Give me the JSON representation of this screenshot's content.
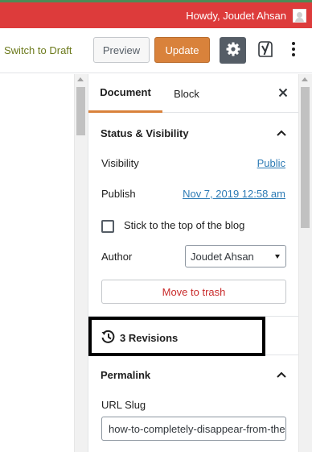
{
  "admin_bar": {
    "greeting": "Howdy, Joudet Ahsan"
  },
  "toolbar": {
    "switch_to_draft": "Switch to Draft",
    "preview": "Preview",
    "update": "Update",
    "settings_icon": "gear-icon",
    "yoast_icon": "yoast-icon",
    "more_icon": "more-vertical-icon"
  },
  "sidebar": {
    "tabs": [
      {
        "label": "Document",
        "active": true
      },
      {
        "label": "Block",
        "active": false
      }
    ],
    "close_icon": "close-icon",
    "status_visibility": {
      "title": "Status & Visibility",
      "visibility_label": "Visibility",
      "visibility_value": "Public",
      "publish_label": "Publish",
      "publish_value": "Nov 7, 2019 12:58 am",
      "sticky_label": "Stick to the top of the blog",
      "sticky_checked": false,
      "author_label": "Author",
      "author_value": "Joudet Ahsan",
      "trash_label": "Move to trash"
    },
    "revisions": {
      "label": "3 Revisions",
      "icon": "history-icon"
    },
    "permalink": {
      "title": "Permalink",
      "slug_label": "URL Slug",
      "slug_value": "how-to-completely-disappear-from-the-internet"
    }
  },
  "colors": {
    "admin_bar": "#dd3b3b",
    "update_button": "#d9823b",
    "link": "#2d7bb5",
    "trash": "#c92c2c",
    "switch_draft": "#6c7a1c"
  }
}
